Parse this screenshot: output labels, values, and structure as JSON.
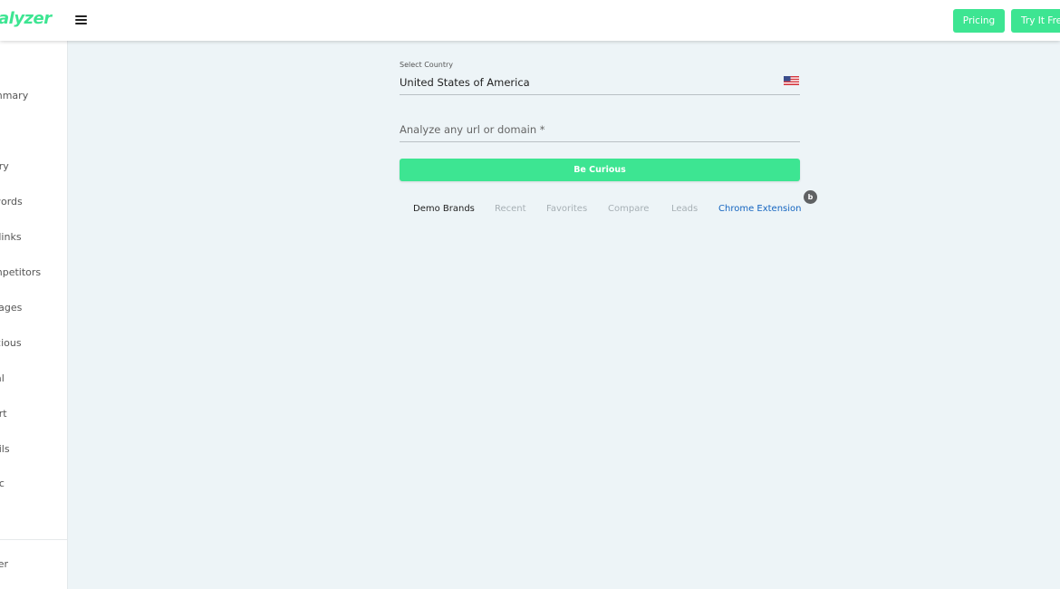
{
  "header": {
    "logo_text": "alyzer",
    "pricing_label": "Pricing",
    "try_free_label": "Try It Free"
  },
  "sidebar": {
    "items": [
      {
        "label": "mmary"
      },
      {
        "label": "ory"
      },
      {
        "label": "words"
      },
      {
        "label": "klinks"
      },
      {
        "label": "mpetitors"
      },
      {
        "label": "Pages"
      },
      {
        "label": "icious"
      },
      {
        "label": "ial"
      },
      {
        "label": "ort"
      },
      {
        "label": "ails"
      },
      {
        "label": "fic"
      }
    ],
    "bottom_item": "zer"
  },
  "main": {
    "country_label": "Select Country",
    "country_value": "United States of America",
    "url_placeholder": "Analyze any url or domain *",
    "cta_label": "Be Curious",
    "tabs": [
      {
        "label": "Demo Brands"
      },
      {
        "label": "Recent"
      },
      {
        "label": "Favorites"
      },
      {
        "label": "Compare"
      },
      {
        "label": "Leads"
      },
      {
        "label": "Chrome Extension"
      }
    ],
    "badge": "b"
  },
  "colors": {
    "accent": "#3de592",
    "link": "#1565c0",
    "background": "#edf4f7"
  },
  "icons": {
    "menu": "hamburger-icon",
    "flag": "us-flag-icon"
  }
}
